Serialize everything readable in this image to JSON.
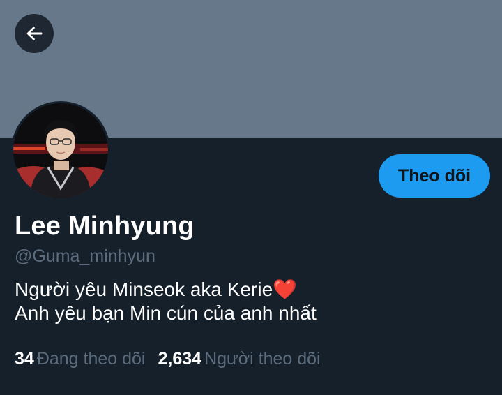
{
  "header": {
    "back_icon": "arrow-left-icon"
  },
  "colors": {
    "background": "#15202b",
    "banner": "#66788a",
    "accent": "#1d9bf0",
    "muted_text": "#5c6c7c",
    "heart": "#e0245e"
  },
  "profile": {
    "follow_label": "Theo dõi",
    "display_name": "Lee Minhyung",
    "handle": "@Guma_minhyun",
    "bio_line1": "Người yêu Minseok aka Kerie",
    "bio_emoji": "❤️",
    "bio_line2": "Anh yêu bạn Min cún của anh nhất"
  },
  "stats": {
    "following_count": "34",
    "following_label": "Đang theo dõi",
    "followers_count": "2,634",
    "followers_label": "Người theo dõi"
  }
}
